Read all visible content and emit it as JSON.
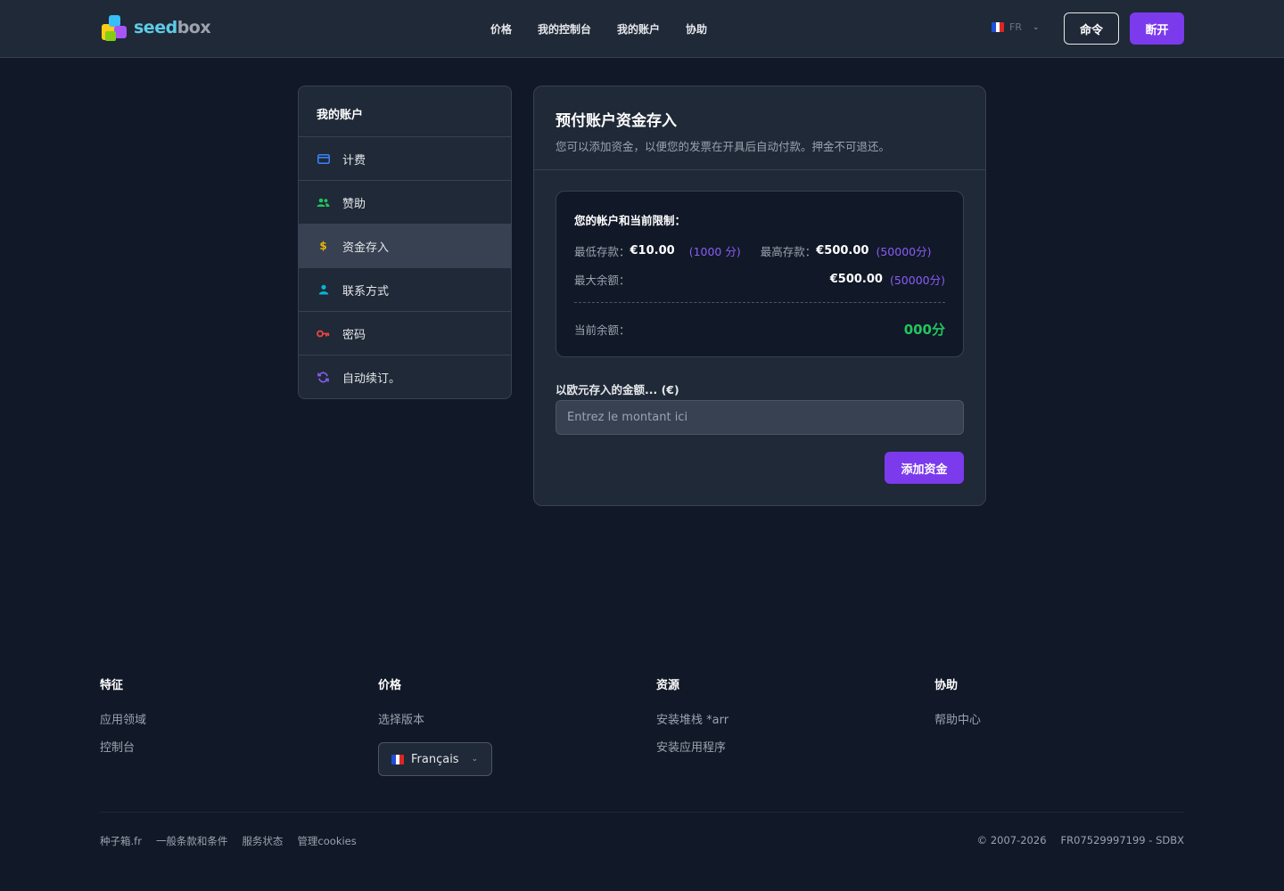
{
  "header": {
    "logo": {
      "part1": "seed",
      "part2": "box"
    },
    "nav": [
      "价格",
      "我的控制台",
      "我的账户",
      "协助"
    ],
    "lang_code": "FR",
    "btn_order": "命令",
    "btn_logout": "断开"
  },
  "sidebar": {
    "title": "我的账户",
    "items": [
      {
        "label": "计费",
        "icon": "credit-card-icon",
        "color": "#3b82f6"
      },
      {
        "label": "赞助",
        "icon": "users-icon",
        "color": "#22c55e"
      },
      {
        "label": "资金存入",
        "icon": "dollar-icon",
        "color": "#eab308",
        "active": true
      },
      {
        "label": "联系方式",
        "icon": "user-icon",
        "color": "#06b6d4"
      },
      {
        "label": "密码",
        "icon": "key-icon",
        "color": "#ef4444"
      },
      {
        "label": "自动续订。",
        "icon": "refresh-icon",
        "color": "#8b5cf6"
      }
    ]
  },
  "main": {
    "title": "预付账户资金存入",
    "subtitle": "您可以添加资金，以便您的发票在开具后自动付款。押金不可退还。",
    "limits": {
      "title": "您的帐户和当前限制：",
      "min_label": "最低存款：",
      "min_value": "€10.00",
      "min_cents": "(1000 分)",
      "max_label": "最高存款：",
      "max_value": "€500.00",
      "max_cents": "(50000分)",
      "maxbal_label": "最大余额：",
      "maxbal_value": "€500.00",
      "maxbal_cents": "(50000分)",
      "balance_label": "当前余额：",
      "balance_value": "000分"
    },
    "amount_label": "以欧元存入的金额... (€)",
    "amount_placeholder": "Entrez le montant ici",
    "add_button": "添加资金"
  },
  "footer": {
    "columns": [
      {
        "title": "特征",
        "links": [
          "应用领域",
          "控制台"
        ]
      },
      {
        "title": "价格",
        "links": [
          "选择版本"
        ]
      },
      {
        "title": "资源",
        "links": [
          "安装堆栈 *arr",
          "安装应用程序"
        ]
      },
      {
        "title": "协助",
        "links": [
          "帮助中心"
        ]
      }
    ],
    "language": "Français",
    "bottom_links": [
      "种子箱.fr",
      "一般条款和条件",
      "服务状态",
      "管理cookies"
    ],
    "copyright": "© 2007-2026",
    "company_id": "FR07529997199 - SDBX"
  },
  "colors": {
    "background": "#111827",
    "surface": "#1f2937",
    "accent": "#7c3aed",
    "success": "#22c55e",
    "cents": "#8b5cf6"
  }
}
